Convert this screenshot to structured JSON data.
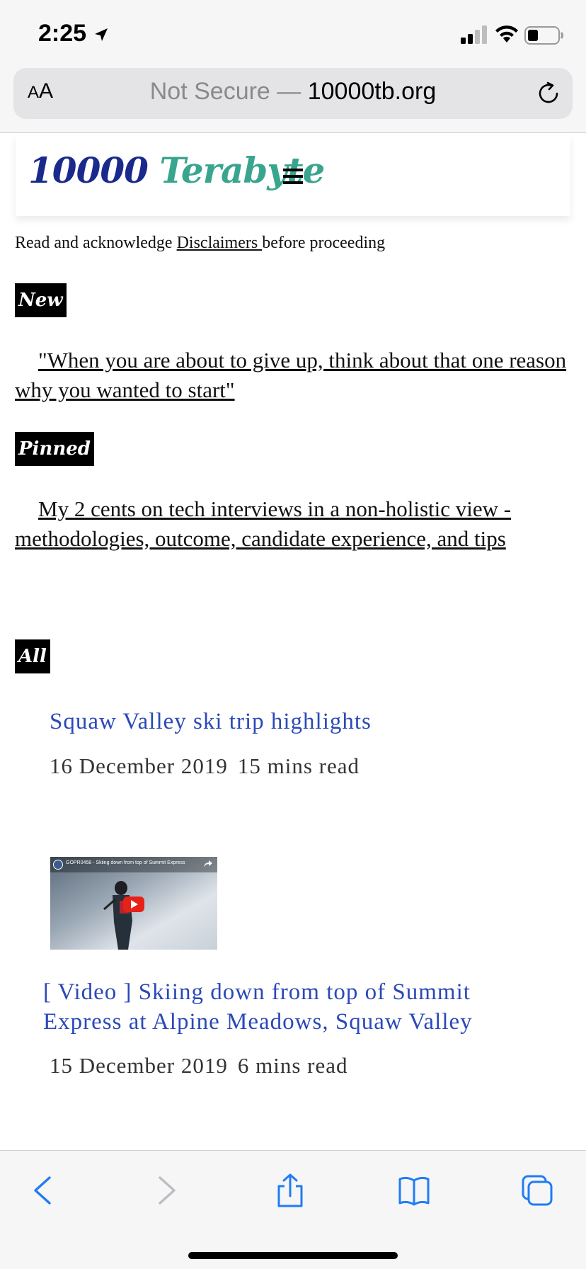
{
  "status_bar": {
    "time": "2:25",
    "icons": [
      "location-arrow-icon",
      "cellular-signal-icon",
      "wifi-icon",
      "battery-icon"
    ]
  },
  "browser": {
    "aa_label_small": "A",
    "aa_label_large": "A",
    "url_prefix": "Not Secure — ",
    "url_domain": "10000tb.org",
    "reload_icon": "reload-icon",
    "accent_color": "#1f7cf5"
  },
  "site": {
    "logo_part1": "10000",
    "logo_part2": "Terabyte",
    "menu_icon": "hamburger-menu-icon"
  },
  "disclaimer": {
    "before": "Read and acknowledge ",
    "link": "Disclaimers ",
    "after": "before proceeding"
  },
  "sections": {
    "new_tag": "New",
    "new_link": "\"When you are about to give up, think about that one reason why you wanted to start\"",
    "pinned_tag": "Pinned",
    "pinned_link": "My 2 cents on tech interviews in a non-holistic view - methodologies, outcome, candidate experience, and tips ",
    "all_tag": "All"
  },
  "posts": [
    {
      "title": "Squaw Valley ski trip highlights",
      "date": "16 December 2019",
      "read_time": "15 mins read"
    },
    {
      "video_caption": "GOPR0458 - Skiing down from top of Summit Express",
      "title": "[ Video ] Skiing down from top of Summit Express at Alpine Meadows, Squaw Valley",
      "date": "15 December 2019",
      "read_time": "6 mins read"
    }
  ],
  "toolbar": {
    "icons": [
      "back-icon",
      "forward-icon",
      "share-icon",
      "bookmarks-icon",
      "tabs-icon"
    ]
  }
}
